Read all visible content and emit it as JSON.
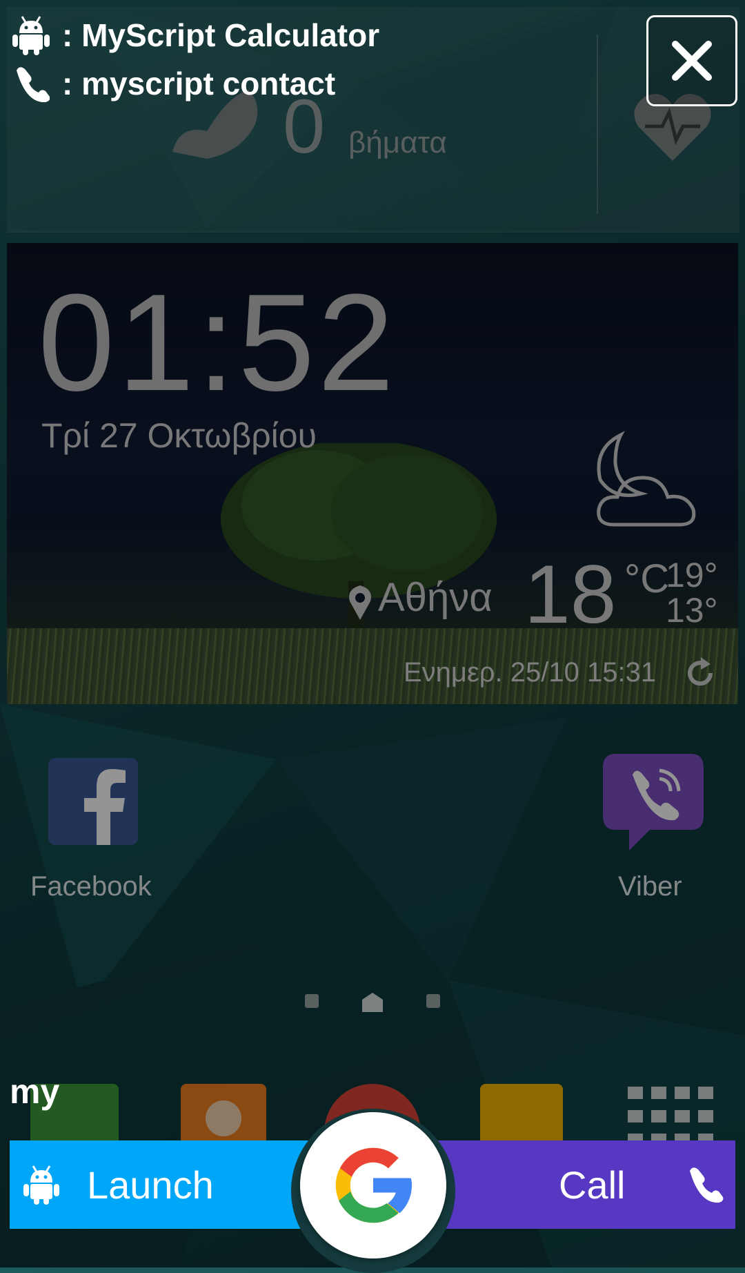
{
  "overlay": {
    "suggestions": [
      {
        "icon": "android-icon",
        "label": ": MyScript Calculator"
      },
      {
        "icon": "phone-icon",
        "label": ": myscript contact"
      }
    ],
    "close_icon": "close-icon",
    "query": "my",
    "launch_label": "Launch",
    "call_label": "Call",
    "google_icon": "google-g-icon"
  },
  "home": {
    "health": {
      "steps": "0",
      "steps_label": "βήματα"
    },
    "clock": {
      "time": "01:52",
      "date": "Τρί 27 Οκτωβρίου",
      "city": "Αθήνα",
      "temp": "18",
      "unit": "°C",
      "high": "19°",
      "low": "13°",
      "updated": "Ενημερ. 25/10 15:31"
    },
    "apps": [
      {
        "name": "Facebook"
      },
      {
        "name": "Viber"
      }
    ]
  },
  "colors": {
    "launch": "#00a6f8",
    "call": "#5638c2",
    "background": "#154749"
  }
}
